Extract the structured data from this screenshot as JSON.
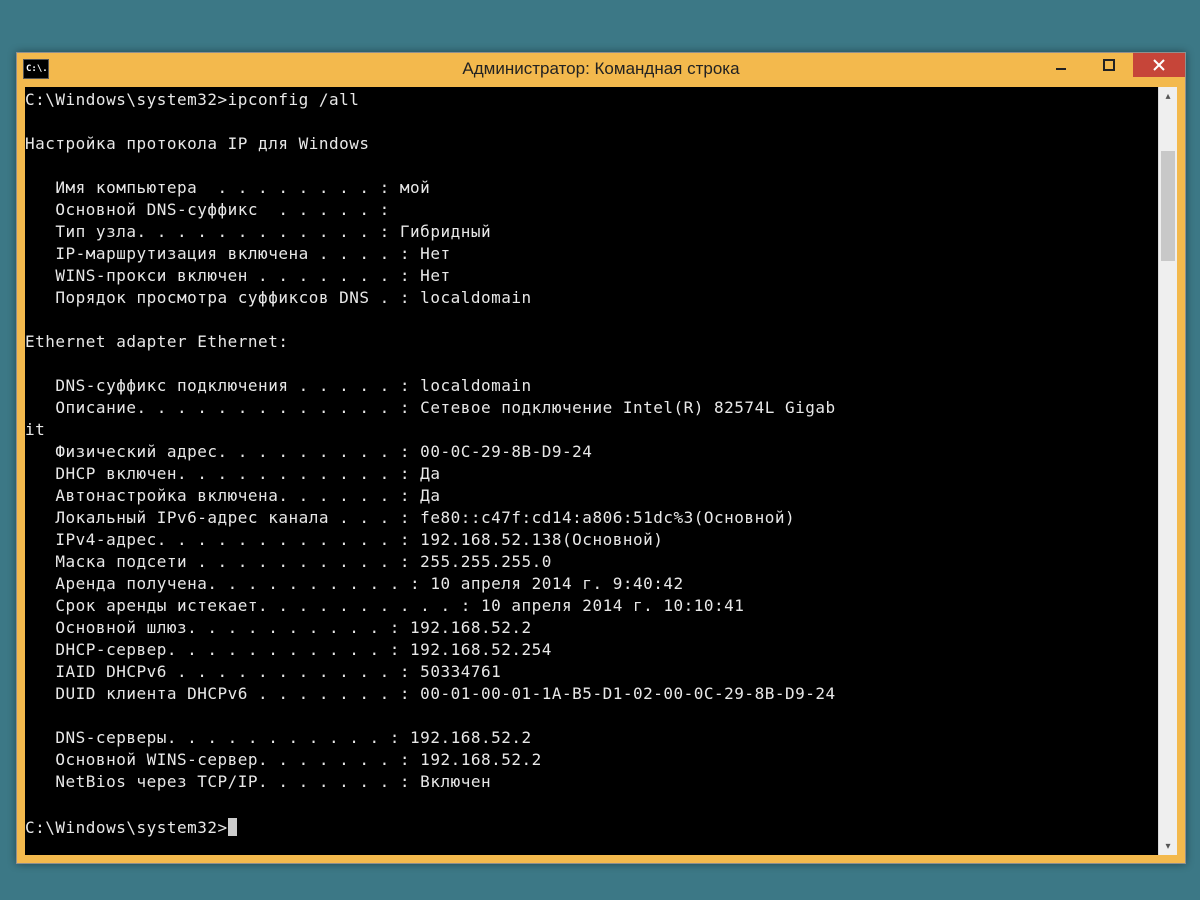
{
  "window": {
    "title": "Администратор: Командная строка",
    "icon_text": "C:\\.",
    "buttons": {
      "min": "–",
      "max": "□",
      "close": "✕"
    }
  },
  "prompt": "C:\\Windows\\system32>",
  "command": "ipconfig /all",
  "sections": {
    "header": "Настройка протокола IP для Windows",
    "host": [
      {
        "k": "Имя компьютера",
        "dots": "  . . . . . . . . :",
        "v": "мой"
      },
      {
        "k": "Основной DNS-суффикс",
        "dots": "  . . . . . :",
        "v": ""
      },
      {
        "k": "Тип узла.",
        "dots": " . . . . . . . . . . . :",
        "v": "Гибридный"
      },
      {
        "k": "IP-маршрутизация включена",
        "dots": " . . . . :",
        "v": "Нет"
      },
      {
        "k": "WINS-прокси включен",
        "dots": " . . . . . . . :",
        "v": "Нет"
      },
      {
        "k": "Порядок просмотра суффиксов DNS",
        "dots": " . :",
        "v": "localdomain"
      }
    ],
    "adapter_title": "Ethernet adapter Ethernet:",
    "adapter": [
      {
        "k": "DNS-суффикс подключения",
        "dots": " . . . . . :",
        "v": "localdomain"
      },
      {
        "k": "Описание.",
        "dots": " . . . . . . . . . . . . :",
        "v": "Сетевое подключение Intel(R) 82574L Gigab",
        "wrap": "it"
      },
      {
        "k": "Физический адрес.",
        "dots": " . . . . . . . . :",
        "v": "00-0C-29-8B-D9-24"
      },
      {
        "k": "DHCP включен.",
        "dots": " . . . . . . . . . . :",
        "v": "Да"
      },
      {
        "k": "Автонастройка включена.",
        "dots": " . . . . . :",
        "v": "Да"
      },
      {
        "k": "Локальный IPv6-адрес канала",
        "dots": " . . . :",
        "v": "fe80::c47f:cd14:a806:51dc%3(Основной)"
      },
      {
        "k": "IPv4-адрес.",
        "dots": " . . . . . . . . . . . :",
        "v": "192.168.52.138(Основной)"
      },
      {
        "k": "Маска подсети",
        "dots": " . . . . . . . . . . :",
        "v": "255.255.255.0"
      },
      {
        "k": "Аренда получена.",
        "dots": " . . . . . . . . . :",
        "v": "10 апреля 2014 г. 9:40:42"
      },
      {
        "k": "Срок аренды истекает.",
        "dots": " . . . . . . . . . :",
        "v": "10 апреля 2014 г. 10:10:41"
      },
      {
        "k": "Основной шлюз.",
        "dots": " . . . . . . . . . :",
        "v": "192.168.52.2"
      },
      {
        "k": "DHCP-сервер.",
        "dots": " . . . . . . . . . . :",
        "v": "192.168.52.254"
      },
      {
        "k": "IAID DHCPv6",
        "dots": " . . . . . . . . . . . :",
        "v": "50334761"
      },
      {
        "k": "DUID клиента DHCPv6",
        "dots": " . . . . . . . :",
        "v": "00-01-00-01-1A-B5-D1-02-00-0C-29-8B-D9-24"
      }
    ],
    "adapter_tail": [
      {
        "k": "DNS-серверы.",
        "dots": " . . . . . . . . . . :",
        "v": "192.168.52.2"
      },
      {
        "k": "Основной WINS-сервер.",
        "dots": " . . . . . . :",
        "v": "192.168.52.2"
      },
      {
        "k": "NetBios через TCP/IP.",
        "dots": " . . . . . . :",
        "v": "Включен"
      }
    ]
  }
}
